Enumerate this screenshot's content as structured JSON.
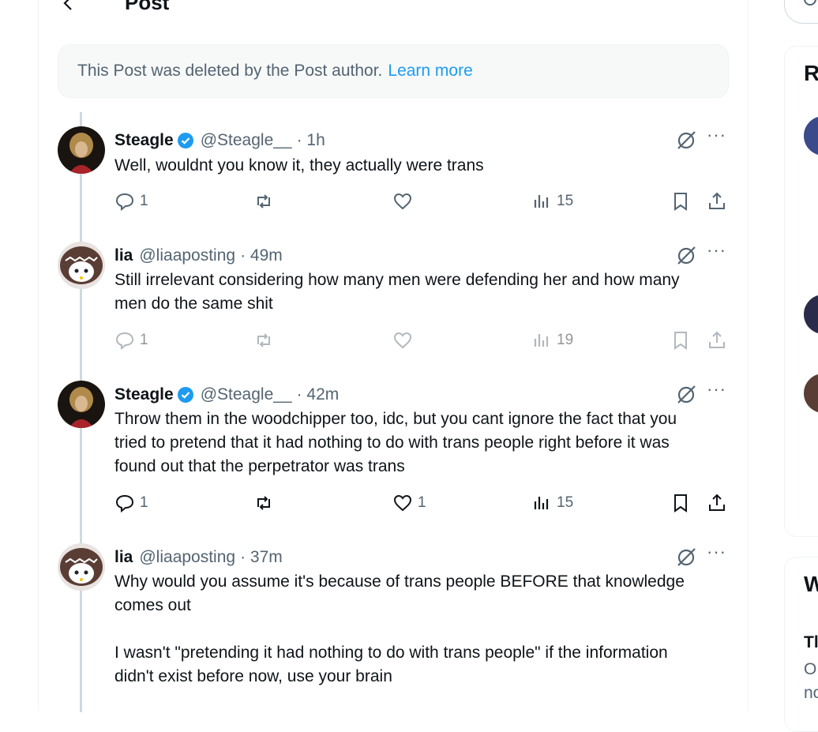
{
  "header": {
    "back_icon": "arrow-left-icon",
    "title": "Post"
  },
  "deleted_notice": {
    "text": "This Post was deleted by the Post author.",
    "link": "Learn more"
  },
  "tweets": [
    {
      "name": "Steagle",
      "verified": true,
      "handle": "@Steagle__",
      "time": "· 1h",
      "text": [
        "Well, wouldnt you know it, they actually were trans"
      ],
      "replies": "1",
      "reposts": "",
      "likes": "",
      "views": "15",
      "faded": false
    },
    {
      "name": "lia",
      "verified": false,
      "handle": "@liaaposting",
      "time": "· 49m",
      "text": [
        "Still irrelevant considering how many men were defending her and how many",
        "men do the same shit"
      ],
      "replies": "1",
      "reposts": "",
      "likes": "",
      "views": "19",
      "faded": true
    },
    {
      "name": "Steagle",
      "verified": true,
      "handle": "@Steagle__",
      "time": "· 42m",
      "text": [
        "Throw them in the woodchipper too, idc, but you cant ignore the fact that you",
        "tried to pretend that it had nothing to do with trans people right before it was",
        "found out that the perpetrator was trans"
      ],
      "replies": "1",
      "reposts": "",
      "likes": "1",
      "views": "15",
      "faded": false
    },
    {
      "name": "lia",
      "verified": false,
      "handle": "@liaaposting",
      "time": "· 37m",
      "text": [
        "Why would you assume it's because of trans people BEFORE that knowledge",
        "comes out",
        "",
        "I wasn't \"pretending it had nothing to do with trans people\" if the information",
        "didn't exist before now, use your brain"
      ]
    }
  ],
  "sidebar": {
    "card1_heading": "R",
    "card2_heading": "W",
    "card2_sub": "Tl",
    "card2_line1": "O",
    "card2_line2": "no"
  },
  "colors": {
    "accent": "#1d9bf0",
    "secondary_text": "#536471",
    "border": "#eff3f4"
  }
}
